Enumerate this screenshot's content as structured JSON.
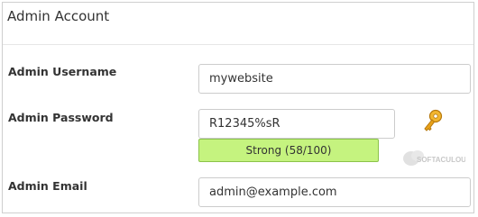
{
  "panel": {
    "title": "Admin Account"
  },
  "username": {
    "label": "Admin Username",
    "value": "mywebsite"
  },
  "password": {
    "label": "Admin Password",
    "value": "R12345%sR",
    "strength_text": "Strong (58/100)",
    "strength_score": 58,
    "generate_icon": "key-icon"
  },
  "email": {
    "label": "Admin Email",
    "value": "admin@example.com"
  },
  "watermark": {
    "text": "SOFTACULOUS"
  },
  "colors": {
    "strength_fill": "#c5f37f",
    "strength_border": "#8bc34a",
    "key_gold": "#e8a21a"
  }
}
